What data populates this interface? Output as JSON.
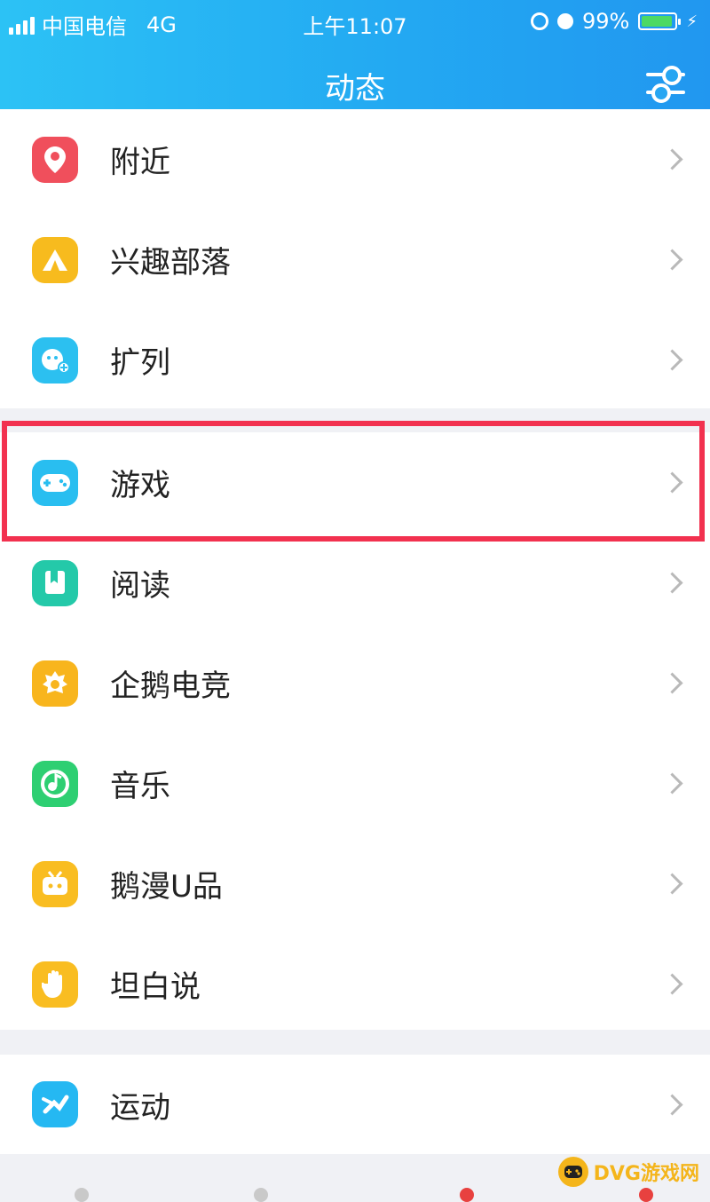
{
  "status": {
    "carrier": "中国电信",
    "network": "4G",
    "time": "上午11:07",
    "battery": "99%"
  },
  "header": {
    "title": "动态"
  },
  "items": [
    {
      "label": "附近",
      "color": "#f04f5c",
      "icon": "location-pin-icon"
    },
    {
      "label": "兴趣部落",
      "color": "#f7bb1e",
      "icon": "tent-icon"
    },
    {
      "label": "扩列",
      "color": "#2cc0f0",
      "icon": "friends-plus-icon"
    },
    {
      "label": "游戏",
      "color": "#29bef0",
      "icon": "gamepad-icon"
    },
    {
      "label": "阅读",
      "color": "#24c9a9",
      "icon": "book-icon"
    },
    {
      "label": "企鹅电竞",
      "color": "#f8b51d",
      "icon": "esports-icon"
    },
    {
      "label": "音乐",
      "color": "#2ecf72",
      "icon": "music-icon"
    },
    {
      "label": "鹅漫U品",
      "color": "#f9bd21",
      "icon": "tv-icon"
    },
    {
      "label": "坦白说",
      "color": "#f9bd21",
      "icon": "hand-icon"
    },
    {
      "label": "运动",
      "color": "#25b8f2",
      "icon": "running-icon"
    }
  ],
  "watermark": "DVG游戏网",
  "colors": {
    "header": "#23a9f2",
    "highlight": "#f2314f",
    "chevron": "#b9b9b9"
  }
}
